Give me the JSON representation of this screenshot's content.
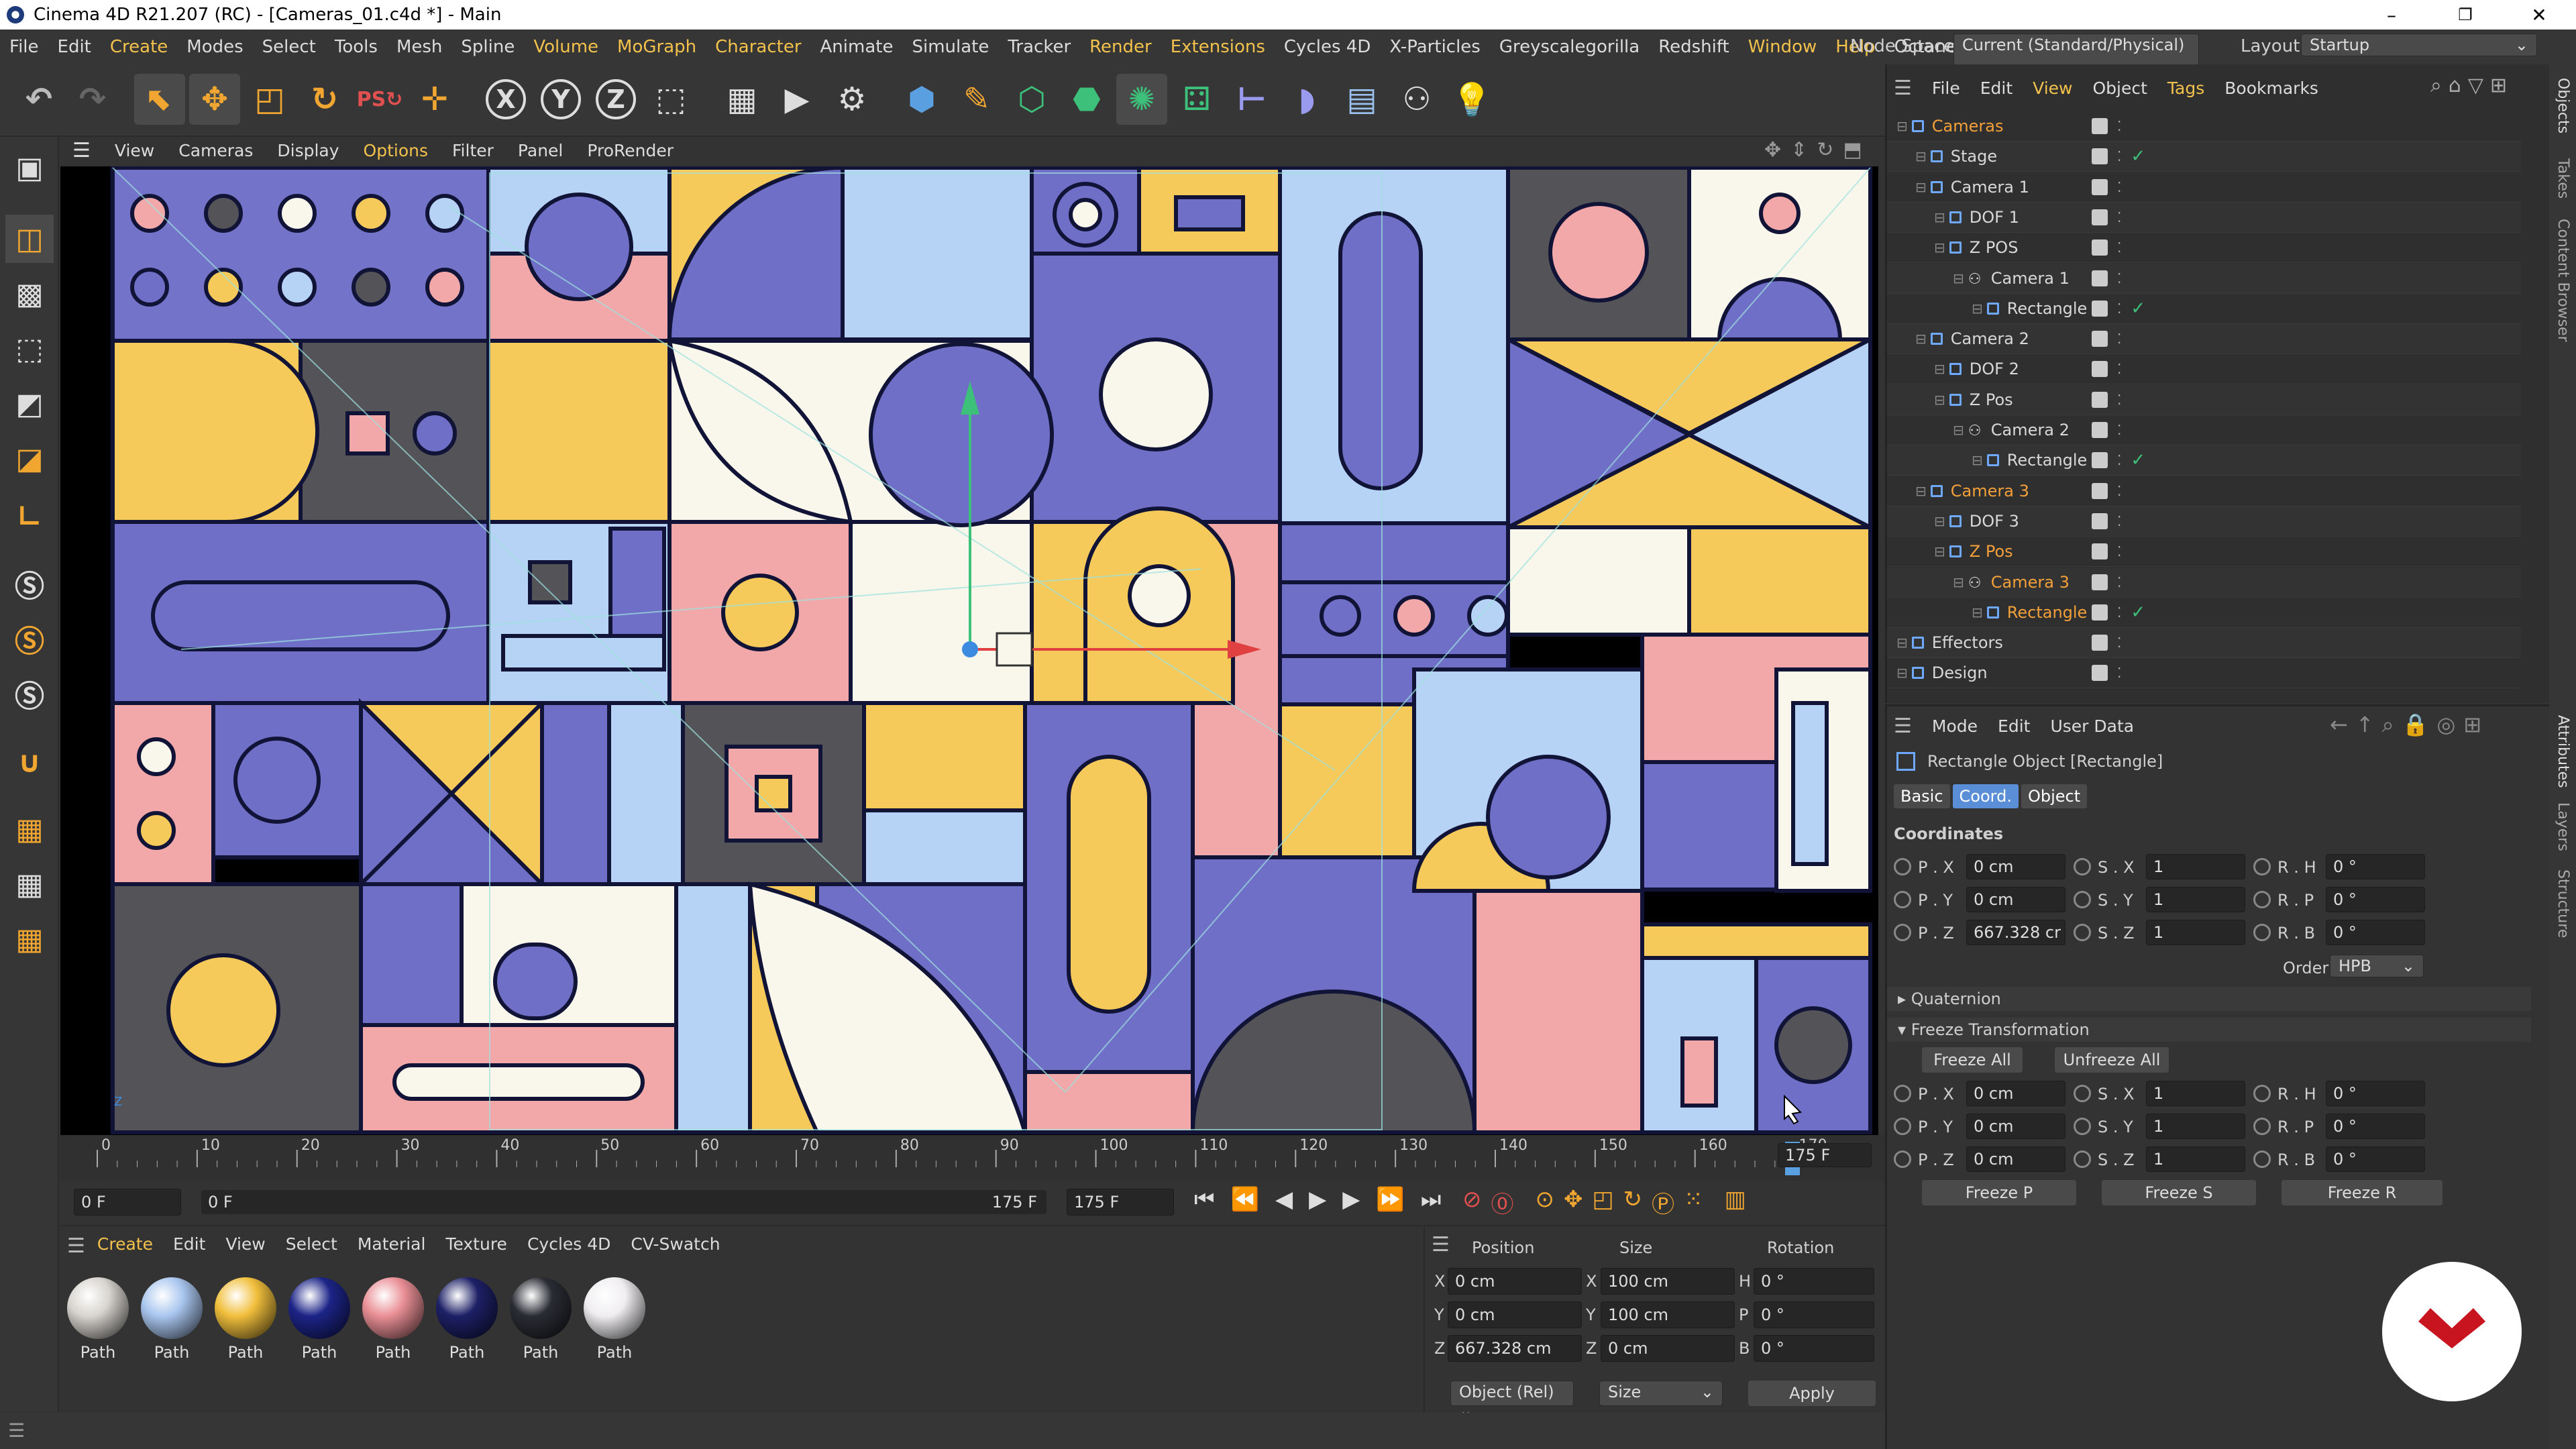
{
  "window": {
    "title": "Cinema 4D R21.207 (RC) - [Cameras_01.c4d *] - Main",
    "min": "–",
    "max": "❐",
    "close": "✕"
  },
  "menubar": {
    "items": [
      "File",
      "Edit",
      "Create",
      "Modes",
      "Select",
      "Tools",
      "Mesh",
      "Spline",
      "Volume",
      "MoGraph",
      "Character",
      "Animate",
      "Simulate",
      "Tracker",
      "Render",
      "Extensions",
      "Cycles 4D",
      "X-Particles",
      "Greyscalegorilla",
      "Redshift",
      "Window",
      "Help",
      "Octane"
    ],
    "node_space_label": "Node Space:",
    "node_space_value": "Current (Standard/Physical)",
    "layout_label": "Layout:",
    "layout_value": "Startup"
  },
  "toolbar": {
    "axis": [
      "X",
      "Y",
      "Z"
    ]
  },
  "viewport": {
    "menu": [
      "View",
      "Cameras",
      "Display",
      "Options",
      "Filter",
      "Panel",
      "ProRender"
    ]
  },
  "timeline": {
    "ticks": [
      "0",
      "10",
      "20",
      "30",
      "40",
      "50",
      "60",
      "70",
      "80",
      "90",
      "100",
      "110",
      "120",
      "130",
      "140",
      "150",
      "160",
      "170"
    ],
    "end_marker": "1",
    "end_frame": "175 F",
    "start_field": "0 F",
    "range_start": "0 F",
    "range_end": "175 F",
    "max_field": "175 F",
    "current_position": 0.97
  },
  "materials": {
    "menu": [
      "Create",
      "Edit",
      "View",
      "Select",
      "Material",
      "Texture",
      "Cycles 4D",
      "CV-Swatch"
    ],
    "items": [
      {
        "label": "Path",
        "color": "#d8d4cf"
      },
      {
        "label": "Path",
        "color": "#a9c6ef"
      },
      {
        "label": "Path",
        "color": "#f1bf3c"
      },
      {
        "label": "Path",
        "color": "#1c2487"
      },
      {
        "label": "Path",
        "color": "#e98f95"
      },
      {
        "label": "Path",
        "color": "#1d2066"
      },
      {
        "label": "Path",
        "color": "#2a2c34"
      },
      {
        "label": "Path",
        "color": "#efedf0"
      }
    ]
  },
  "coords": {
    "headers": [
      "Position",
      "Size",
      "Rotation"
    ],
    "rows": [
      {
        "axis": "X",
        "pos": "0 cm",
        "saxis": "X",
        "size": "100 cm",
        "raxis": "H",
        "rot": "0 °"
      },
      {
        "axis": "Y",
        "pos": "0 cm",
        "saxis": "Y",
        "size": "100 cm",
        "raxis": "P",
        "rot": "0 °"
      },
      {
        "axis": "Z",
        "pos": "667.328 cm",
        "saxis": "Z",
        "size": "0 cm",
        "raxis": "B",
        "rot": "0 °"
      }
    ],
    "mode": "Object (Rel)",
    "size_mode": "Size",
    "apply": "Apply"
  },
  "objects": {
    "menu": [
      "File",
      "Edit",
      "View",
      "Object",
      "Tags",
      "Bookmarks"
    ],
    "tree": [
      {
        "name": "Cameras",
        "depth": 0,
        "hl": true,
        "check": false
      },
      {
        "name": "Stage",
        "depth": 1,
        "hl": false,
        "check": true
      },
      {
        "name": "Camera 1",
        "depth": 1,
        "hl": false,
        "check": false
      },
      {
        "name": "DOF 1",
        "depth": 2,
        "hl": false,
        "check": false
      },
      {
        "name": "Z POS",
        "depth": 2,
        "hl": false,
        "check": false
      },
      {
        "name": "Camera 1",
        "depth": 3,
        "hl": false,
        "check": false
      },
      {
        "name": "Rectangle",
        "depth": 4,
        "hl": false,
        "check": true
      },
      {
        "name": "Camera 2",
        "depth": 1,
        "hl": false,
        "check": false
      },
      {
        "name": "DOF 2",
        "depth": 2,
        "hl": false,
        "check": false
      },
      {
        "name": "Z Pos",
        "depth": 2,
        "hl": false,
        "check": false
      },
      {
        "name": "Camera 2",
        "depth": 3,
        "hl": false,
        "check": false
      },
      {
        "name": "Rectangle",
        "depth": 4,
        "hl": false,
        "check": true
      },
      {
        "name": "Camera 3",
        "depth": 1,
        "hl": true,
        "check": false
      },
      {
        "name": "DOF 3",
        "depth": 2,
        "hl": false,
        "check": false
      },
      {
        "name": "Z Pos",
        "depth": 2,
        "hl": true,
        "check": false
      },
      {
        "name": "Camera 3",
        "depth": 3,
        "hl": true,
        "check": false
      },
      {
        "name": "Rectangle",
        "depth": 4,
        "hl": true,
        "check": true
      },
      {
        "name": "Effectors",
        "depth": 0,
        "hl": false,
        "check": false
      },
      {
        "name": "Design",
        "depth": 0,
        "hl": false,
        "check": false
      }
    ]
  },
  "attributes": {
    "menu": [
      "Mode",
      "Edit",
      "User Data"
    ],
    "object_title": "Rectangle Object [Rectangle]",
    "tabs": [
      "Basic",
      "Coord.",
      "Object"
    ],
    "active_tab": "Coord.",
    "coords_title": "Coordinates",
    "fields": [
      {
        "label": "P . X",
        "value": "0 cm"
      },
      {
        "label": "S . X",
        "value": "1"
      },
      {
        "label": "R . H",
        "value": "0 °"
      },
      {
        "label": "P . Y",
        "value": "0 cm"
      },
      {
        "label": "S . Y",
        "value": "1"
      },
      {
        "label": "R . P",
        "value": "0 °"
      },
      {
        "label": "P . Z",
        "value": "667.328 cr"
      },
      {
        "label": "S . Z",
        "value": "1"
      },
      {
        "label": "R . B",
        "value": "0 °"
      }
    ],
    "order_label": "Order",
    "order_value": "HPB",
    "quaternion": "Quaternion",
    "freeze": "Freeze Transformation",
    "freeze_all": "Freeze All",
    "unfreeze_all": "Unfreeze All",
    "frozen": [
      {
        "label": "P . X",
        "value": "0 cm"
      },
      {
        "label": "S . X",
        "value": "1"
      },
      {
        "label": "R . H",
        "value": "0 °"
      },
      {
        "label": "P . Y",
        "value": "0 cm"
      },
      {
        "label": "S . Y",
        "value": "1"
      },
      {
        "label": "R . P",
        "value": "0 °"
      },
      {
        "label": "P . Z",
        "value": "0 cm"
      },
      {
        "label": "S . Z",
        "value": "1"
      },
      {
        "label": "R . B",
        "value": "0 °"
      }
    ],
    "freeze_p": "Freeze P",
    "freeze_s": "Freeze S",
    "freeze_r": "Freeze R"
  },
  "right_strip": [
    "Objects",
    "Takes",
    "Content Browser",
    "Attributes",
    "Layers",
    "Structure"
  ]
}
